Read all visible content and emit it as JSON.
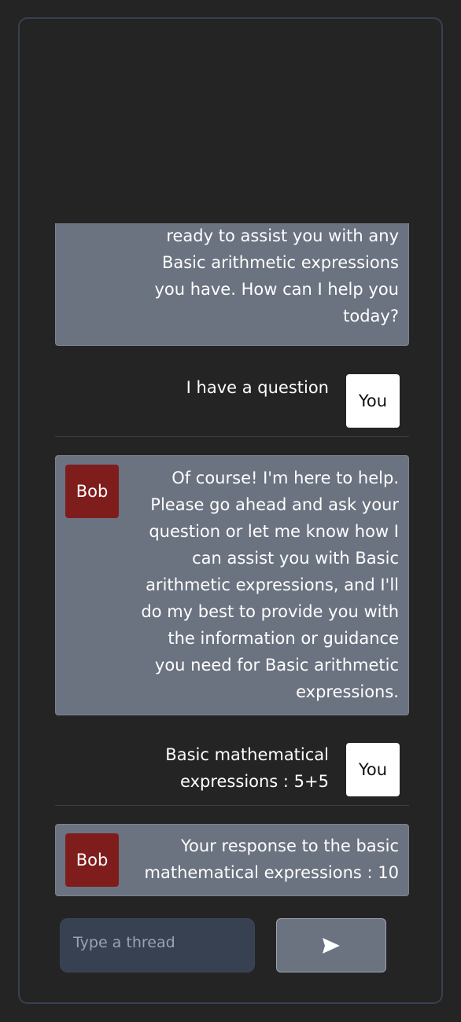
{
  "messages": [
    {
      "role": "bot",
      "avatar": "",
      "lines": [
        "ready to assist you with any",
        "Basic arithmetic expressions",
        "you have. How can I help you",
        "today?"
      ]
    },
    {
      "role": "user",
      "avatar": "You",
      "lines": [
        "I have a question"
      ]
    },
    {
      "role": "bot",
      "avatar": "Bob",
      "lines": [
        "Of course! I'm here to help.",
        "Please go ahead and ask your",
        "question or let me know how I",
        "can assist you with Basic",
        "arithmetic expressions, and I'll",
        "do my best to provide you with",
        "the information or guidance",
        "you need for Basic arithmetic",
        "expressions."
      ]
    },
    {
      "role": "user",
      "avatar": "You",
      "lines": [
        "Basic mathematical",
        "expressions : 5+5"
      ]
    },
    {
      "role": "bot",
      "avatar": "Bob",
      "lines": [
        "Your response to the basic",
        "mathematical expressions : 10"
      ]
    }
  ],
  "composer": {
    "placeholder": "Type a thread",
    "send_icon": "send-arrow-icon"
  },
  "colors": {
    "background": "#242424",
    "bot_bubble": "#6b7280",
    "bot_avatar": "#7f1d1d",
    "user_avatar": "#ffffff",
    "input_bg": "#374151"
  }
}
